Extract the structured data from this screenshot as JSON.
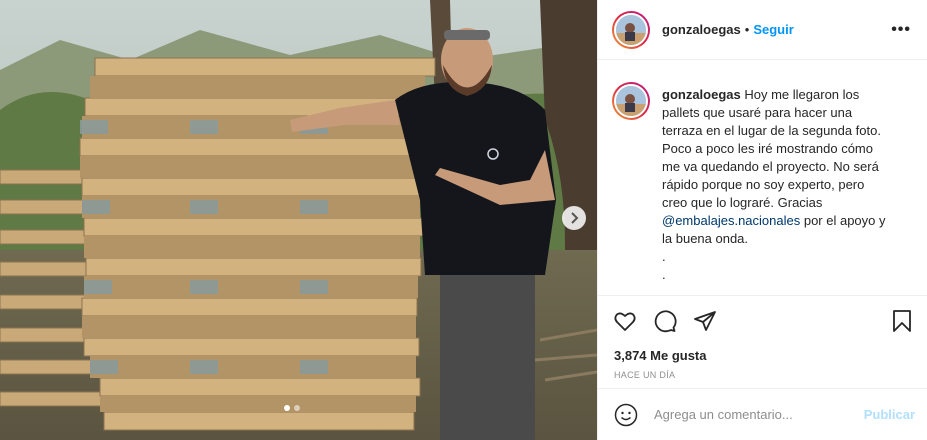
{
  "post": {
    "username": "gonzaloegas",
    "separator": "•",
    "follow_label": "Seguir",
    "more_label": "•••",
    "caption": {
      "username": "gonzaloegas",
      "lines": [
        "Hoy me llegaron los",
        "pallets que usaré para hacer una",
        "terraza en el lugar de la segunda foto.",
        "Poco a poco les iré mostrando cómo",
        "me va quedando el proyecto. No será",
        "rápido porque no soy experto, pero",
        "creo que lo lograré. Gracias"
      ],
      "mention": "@embalajes.nacionales",
      "after_mention": " por el apoyo y",
      "last_line": "la buena onda.",
      "dot1": ".",
      "dot2": "."
    },
    "likes": "3,874 Me gusta",
    "time": "HACE UN DÍA",
    "comment_placeholder": "Agrega un comentario...",
    "publish_label": "Publicar",
    "carousel": {
      "total": 2,
      "active": 0
    }
  },
  "colors": {
    "accent": "#0095f6",
    "publish_disabled": "#b2dffc",
    "muted": "#8e8e8e",
    "mention": "#00376b"
  },
  "icons": [
    "heart-icon",
    "comment-icon",
    "share-icon",
    "bookmark-icon",
    "emoji-icon",
    "chevron-right-icon",
    "more-icon"
  ]
}
